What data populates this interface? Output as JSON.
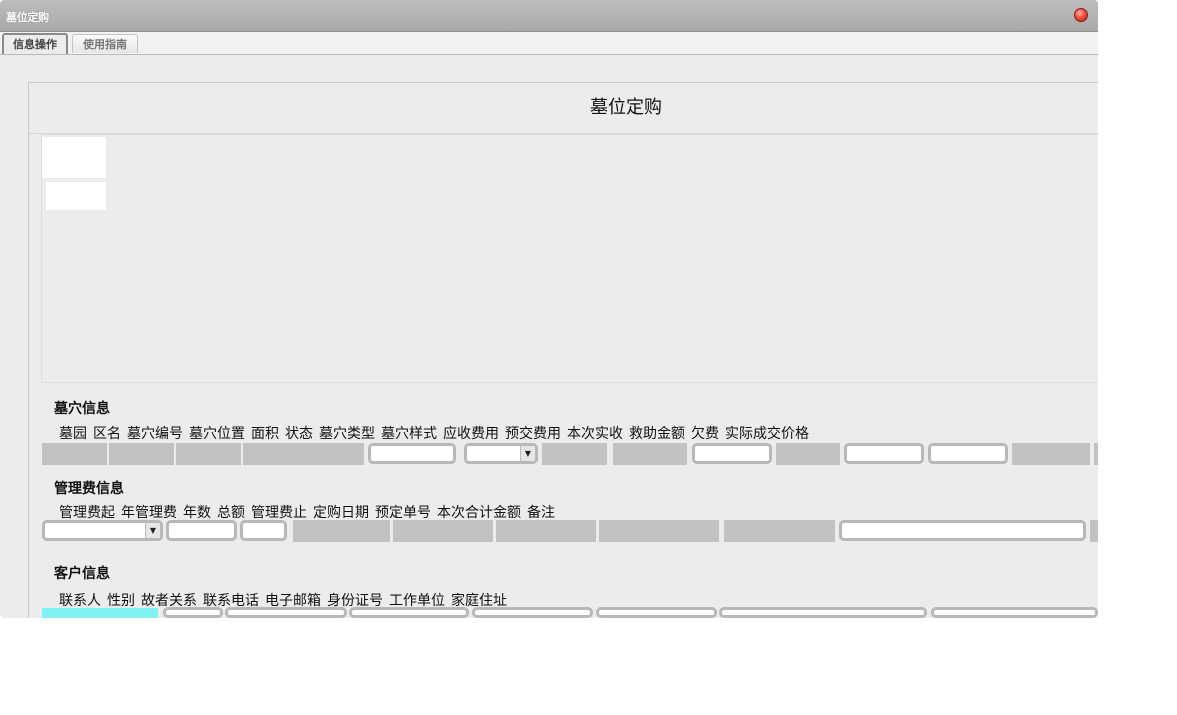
{
  "window": {
    "title": "墓位定购"
  },
  "tabs": [
    {
      "label": "信息操作"
    },
    {
      "label": "使用指南"
    }
  ],
  "page_title": "墓位定购",
  "sections": {
    "grave": {
      "title": "墓穴信息",
      "labels": [
        "墓园",
        "区名",
        "墓穴编号",
        "墓穴位置",
        "面积",
        "状态",
        "墓穴类型",
        "墓穴样式",
        "应收费用",
        "预交费用",
        "本次实收",
        "救助金额",
        "欠费",
        "实际成交价格"
      ]
    },
    "management": {
      "title": "管理费信息",
      "labels": [
        "管理费起",
        "年管理费",
        "年数",
        "总额",
        "管理费止",
        "定购日期",
        "预定单号",
        "本次合计金额",
        "备注"
      ]
    },
    "customer": {
      "title": "客户信息",
      "labels": [
        "联系人",
        "性别",
        "故者关系",
        "联系电话",
        "电子邮箱",
        "身份证号",
        "工作单位",
        "家庭住址"
      ]
    }
  },
  "colors": {
    "close_button": "#f04e3a",
    "contact_field": "#7ff3f3",
    "readonly_cell": "#c2c2c2"
  },
  "icons": {
    "close": "close-icon",
    "dropdown": "chevron-down-icon"
  }
}
